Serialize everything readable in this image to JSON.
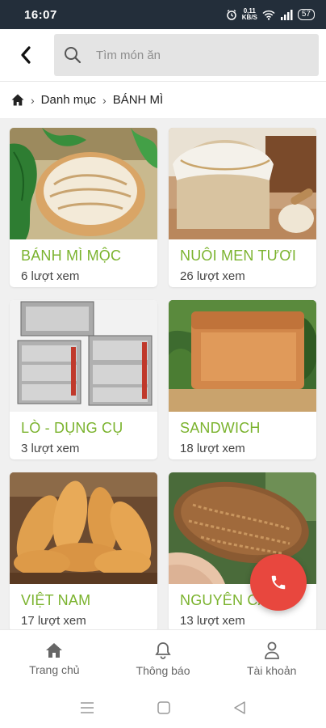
{
  "status": {
    "time": "16:07",
    "speed_top": "0,11",
    "speed_bottom": "KB/S",
    "battery": "57"
  },
  "search": {
    "placeholder": "Tìm món ăn"
  },
  "breadcrumb": {
    "category": "Danh mục",
    "current": "BÁNH MÌ"
  },
  "cards": [
    {
      "title": "BÁNH MÌ MỘC",
      "views": "6 lượt xem"
    },
    {
      "title": "NUÔI MEN TƯƠI",
      "views": "26 lượt xem"
    },
    {
      "title": "LÒ - DỤNG CỤ",
      "views": "3 lượt xem"
    },
    {
      "title": "SANDWICH",
      "views": "18 lượt xem"
    },
    {
      "title": "VIỆT NAM",
      "views": "17 lượt xem"
    },
    {
      "title": "NGUYÊN CÁ",
      "views": "13 lượt xem"
    }
  ],
  "nav": {
    "home": "Trang chủ",
    "notifications": "Thông báo",
    "account": "Tài khoản"
  },
  "colors": {
    "accent": "#7bb32e",
    "fab": "#e8473e",
    "statusbar": "#232e3a"
  }
}
